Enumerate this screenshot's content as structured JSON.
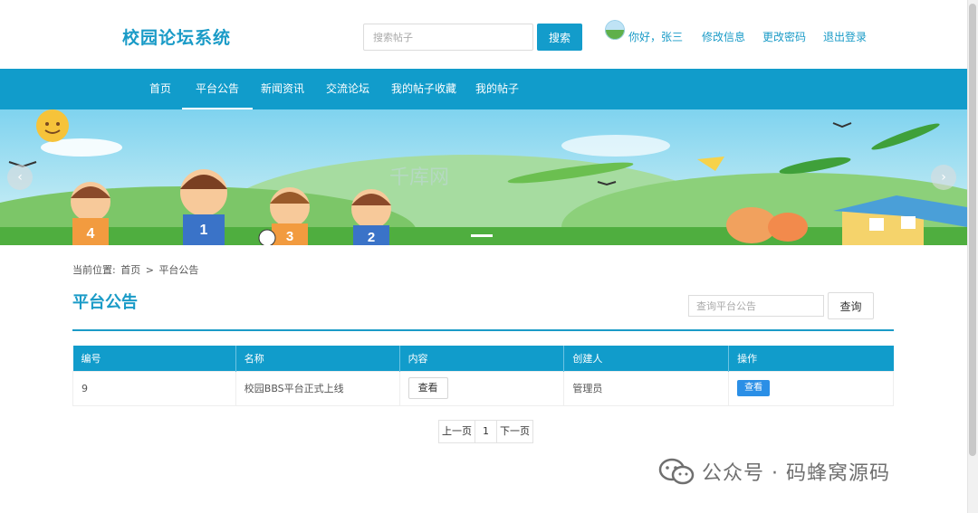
{
  "header": {
    "logo": "校园论坛系统",
    "search_placeholder": "搜索帖子",
    "search_button": "搜索",
    "greeting": "你好，张三",
    "edit_info": "修改信息",
    "change_password": "更改密码",
    "logout": "退出登录"
  },
  "nav": {
    "items": [
      {
        "label": "首页"
      },
      {
        "label": "平台公告"
      },
      {
        "label": "新闻资讯"
      },
      {
        "label": "交流论坛"
      },
      {
        "label": "我的帖子收藏"
      },
      {
        "label": "我的帖子"
      }
    ],
    "active": "平台公告"
  },
  "banner": {
    "jersey_numbers": [
      "4",
      "1",
      "3",
      "2"
    ],
    "watermark": "千库网"
  },
  "breadcrumb": {
    "prefix": "当前位置:",
    "home": "首页",
    "separator": ">",
    "current": "平台公告"
  },
  "main": {
    "title": "平台公告",
    "query_placeholder": "查询平台公告",
    "query_button": "查询",
    "table": {
      "headers": [
        "编号",
        "名称",
        "内容",
        "创建人",
        "操作"
      ],
      "rows": [
        {
          "id": "9",
          "name": "校园BBS平台正式上线",
          "content_button": "查看",
          "creator": "管理员",
          "action_button": "查看"
        }
      ]
    },
    "pagination": {
      "prev": "上一页",
      "current": "1",
      "next": "下一页"
    }
  },
  "watermark": {
    "text": "公众号 · 码蜂窝源码"
  },
  "colors": {
    "primary": "#119ccb",
    "logo": "#1a9bc7",
    "action": "#2b8fe6"
  }
}
